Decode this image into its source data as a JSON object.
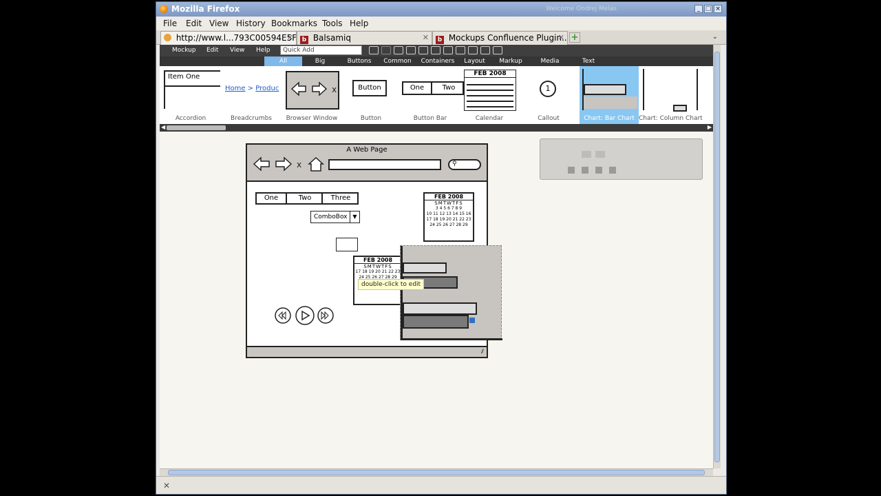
{
  "window": {
    "title": "Mozilla Firefox",
    "ghost_text": "Welcome Ondrej Melas"
  },
  "menu": {
    "file": "File",
    "edit": "Edit",
    "view": "View",
    "history": "History",
    "bookmarks": "Bookmarks",
    "tools": "Tools",
    "help": "Help"
  },
  "tabs": [
    {
      "label": "http://www.l...793C00594E5F",
      "close": "✕"
    },
    {
      "label": "Balsamiq",
      "close": "✕"
    },
    {
      "label": "Mockups Confluence Plugin...",
      "close": "✕"
    }
  ],
  "balsamiq": {
    "menu": {
      "mockup": "Mockup",
      "edit": "Edit",
      "view": "View",
      "help": "Help"
    },
    "quick_add_placeholder": "Quick Add",
    "categories": [
      "All",
      "Big",
      "Buttons",
      "Common",
      "Containers",
      "Layout",
      "Markup",
      "Media",
      "Text"
    ],
    "selected_category": "All",
    "library": [
      "Accordion",
      "Breadcrumbs",
      "Browser Window",
      "Button",
      "Button Bar",
      "Calendar",
      "Callout",
      "Chart: Bar Chart",
      "Chart: Column Chart"
    ],
    "selected_library_item": "Chart: Bar Chart",
    "thumbs": {
      "accordion_item": "Item One",
      "bc_home": "Home",
      "bc_sep": ">",
      "bc_product": "Produc",
      "button": "Button",
      "bar_one": "One",
      "bar_two": "Two",
      "cal_title": "FEB 2008",
      "callout": "1"
    }
  },
  "canvas": {
    "browser_title": "A Web Page",
    "tabs": [
      "One",
      "Two",
      "Three"
    ],
    "combobox": "ComboBox",
    "calendar_title": "FEB 2008",
    "calendar_days": "SMTWTFS",
    "calendar_rows": [
      "        1 2",
      "3 4 5 6 7 8 9",
      "10 11 12 13 14 15 16",
      "17 18 19 20 21 22 23",
      "24 25 26 27 28 29"
    ],
    "tooltip": "double-click to edit",
    "stop_icon": "X"
  },
  "colors": {
    "selected_blue": "#89c7f3",
    "chart_bg": "#c8c4c0",
    "bar_fill": "#7a7a7a"
  }
}
